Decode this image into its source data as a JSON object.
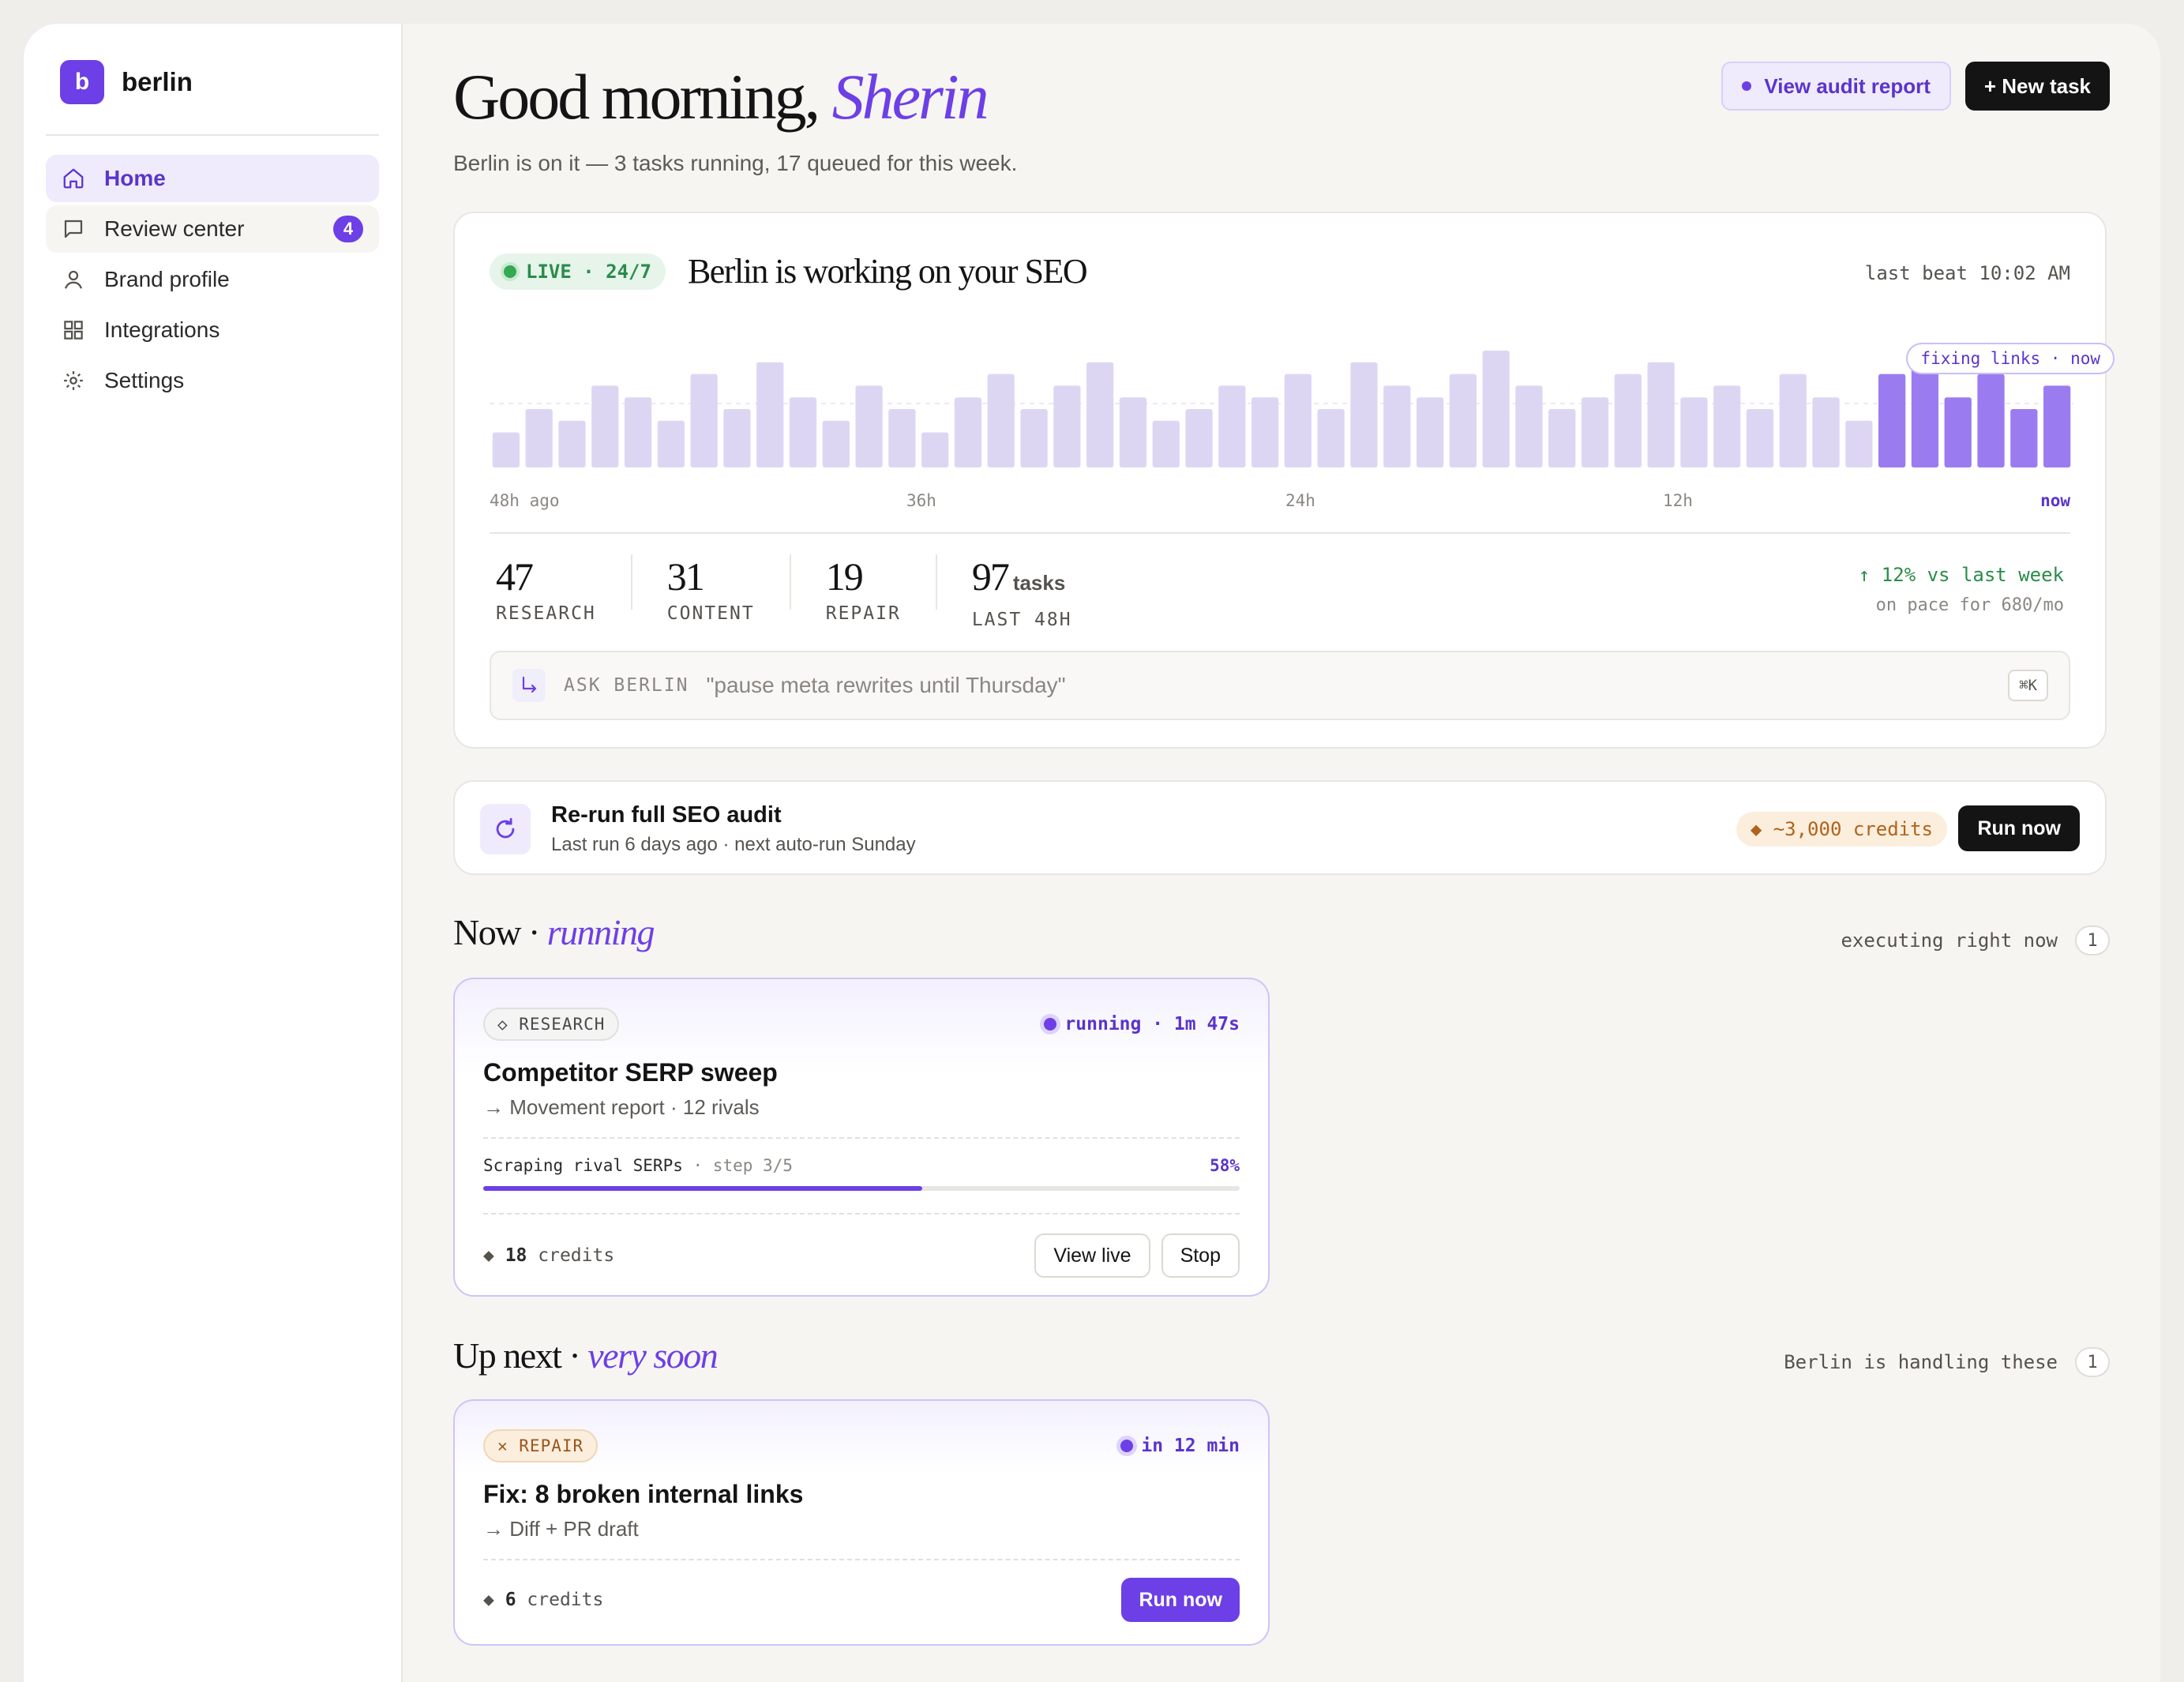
{
  "sidebar": {
    "brand_letter": "b",
    "brand_name": "berlin",
    "items": [
      {
        "label": "Home",
        "icon": "home-icon",
        "active": true
      },
      {
        "label": "Review center",
        "icon": "message-icon",
        "badge": "4"
      },
      {
        "label": "Brand profile",
        "icon": "user-icon"
      },
      {
        "label": "Integrations",
        "icon": "grid-icon"
      },
      {
        "label": "Settings",
        "icon": "gear-icon"
      }
    ]
  },
  "header": {
    "greeting": "Good morning,",
    "name": "Sherin",
    "subline": "Berlin is on it — 3 tasks running, 17 queued for this week.",
    "audit_button": "View audit report",
    "new_task_button": "+ New task"
  },
  "activity": {
    "live_label": "LIVE · 24/7",
    "title": "Berlin is working on your SEO",
    "last_beat": "last beat 10:02 AM",
    "fixing_pill": "fixing links · now",
    "ticks": [
      "48h ago",
      "36h",
      "24h",
      "12h",
      "now"
    ],
    "stats": [
      {
        "num": "47",
        "label": "RESEARCH"
      },
      {
        "num": "31",
        "label": "CONTENT"
      },
      {
        "num": "19",
        "label": "REPAIR"
      },
      {
        "num": "97",
        "unit": "tasks",
        "label": "LAST 48H"
      }
    ],
    "trend": "↑ 12% vs last week",
    "trend_sub": "on pace for 680/mo",
    "ask_label": "ASK BERLIN",
    "ask_placeholder": "\"pause meta rewrites until Thursday\"",
    "ask_shortcut": "⌘K"
  },
  "chart_data": {
    "type": "bar",
    "values": [
      3,
      5,
      4,
      7,
      6,
      4,
      8,
      5,
      9,
      6,
      4,
      7,
      5,
      3,
      6,
      8,
      5,
      7,
      9,
      6,
      4,
      5,
      7,
      6,
      8,
      5,
      9,
      7,
      6,
      8,
      10,
      7,
      5,
      6,
      8,
      9,
      6,
      7,
      5,
      8,
      6,
      4,
      8,
      9,
      6,
      8,
      5,
      7
    ],
    "highlight_last": 6,
    "colors": {
      "normal": "#ddd6f3",
      "recent": "#9b7cf0"
    }
  },
  "audit": {
    "title": "Re-run full SEO audit",
    "subtitle": "Last run 6 days ago · next auto-run Sunday",
    "credits": "◆ ~3,000 credits",
    "button": "Run now"
  },
  "now": {
    "title_main": "Now · ",
    "title_accent": "running",
    "meta": "executing right now",
    "count": "1",
    "task": {
      "tag": "◇ RESEARCH",
      "status": "running · 1m 47s",
      "title": "Competitor SERP sweep",
      "subtitle": "→ Movement report · 12 rivals",
      "step": "Scraping rival SERPs",
      "step_sep": " · step 3/5",
      "percent": "58%",
      "progress": 0.58,
      "credits_num": "18",
      "credits_word": " credits",
      "view_button": "View live",
      "stop_button": "Stop"
    }
  },
  "next": {
    "title_main": "Up next · ",
    "title_accent": "very soon",
    "meta": "Berlin is handling these",
    "count": "1",
    "task": {
      "tag": "✕ REPAIR",
      "status": "in 12 min",
      "title": "Fix: 8 broken internal links",
      "subtitle": "→ Diff + PR draft",
      "credits_num": "6",
      "credits_word": " credits",
      "run_button": "Run now"
    }
  }
}
